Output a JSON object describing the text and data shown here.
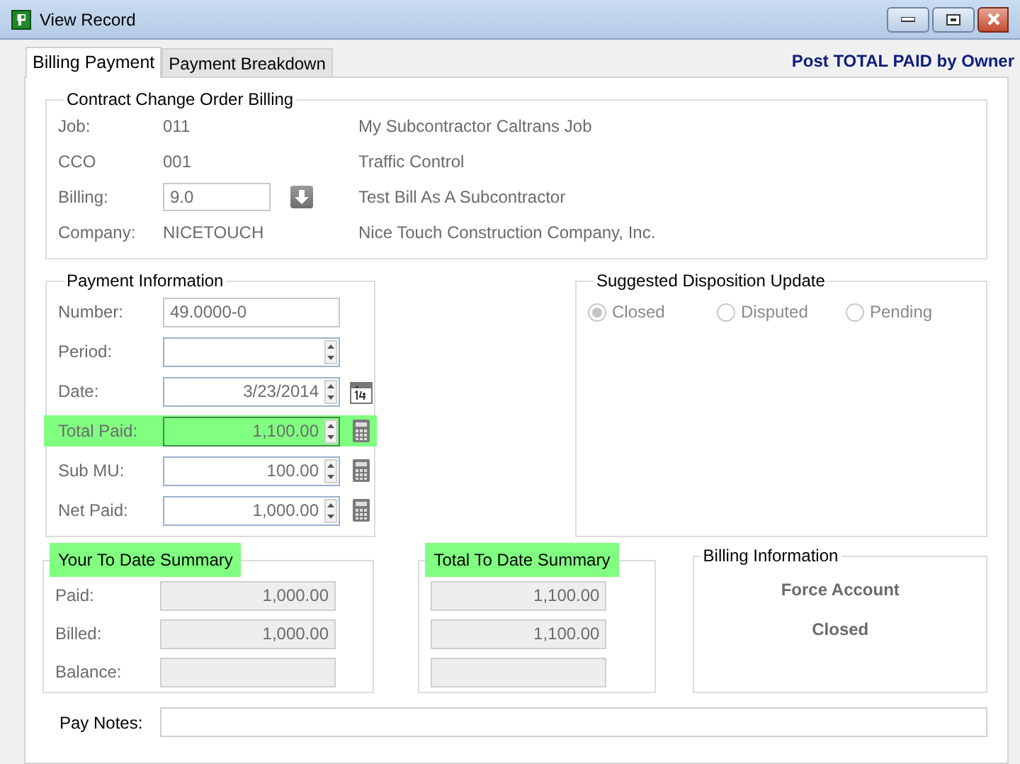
{
  "window": {
    "title": "View Record"
  },
  "tabs": [
    {
      "label": "Billing Payment",
      "selected": true
    },
    {
      "label": "Payment Breakdown",
      "selected": false
    }
  ],
  "header_link": "Post TOTAL PAID by Owner",
  "contract_change_order_billing": {
    "title": "Contract Change Order Billing",
    "rows": [
      {
        "label": "Job:",
        "value": "011",
        "kind": "plain",
        "description": "My Subcontractor Caltrans Job"
      },
      {
        "label": "CCO",
        "value": "001",
        "kind": "plain",
        "description": "Traffic Control"
      },
      {
        "label": "Billing:",
        "value": "9.0",
        "kind": "lookup",
        "description": "Test Bill As A Subcontractor"
      },
      {
        "label": "Company:",
        "value": "NICETOUCH",
        "kind": "plain",
        "description": "Nice Touch Construction Company, Inc."
      }
    ]
  },
  "payment_information": {
    "title": "Payment Information",
    "fields": [
      {
        "label": "Number:",
        "value": "49.0000-0",
        "kind": "text",
        "highlighted": false
      },
      {
        "label": "Period:",
        "kind": "spin",
        "highlighted": false
      },
      {
        "label": "Date:",
        "value": "3/23/2014",
        "kind": "date",
        "highlighted": false
      },
      {
        "label": "Total Paid:",
        "value": "1,100.00",
        "kind": "amount",
        "highlighted": true
      },
      {
        "label": "Sub MU:",
        "value": "100.00",
        "kind": "amount",
        "highlighted": false
      },
      {
        "label": "Net Paid:",
        "value": "1,000.00",
        "kind": "amount",
        "highlighted": false
      }
    ]
  },
  "suggested_disposition_update": {
    "title": "Suggested Disposition Update",
    "disabled": true,
    "options": [
      {
        "label": "Closed",
        "selected": true
      },
      {
        "label": "Disputed",
        "selected": false
      },
      {
        "label": "Pending",
        "selected": false
      }
    ]
  },
  "your_to_date_summary": {
    "title": "Your To Date Summary",
    "highlighted": true,
    "fields": [
      {
        "label": "Paid:",
        "value": "1,000.00",
        "disabled": true
      },
      {
        "label": "Billed:",
        "value": "1,000.00",
        "disabled": true
      },
      {
        "label": "Balance:",
        "disabled": true
      }
    ]
  },
  "total_to_date_summary": {
    "title": "Total To Date Summary",
    "highlighted": true,
    "fields": [
      {
        "value": "1,100.00",
        "disabled": true
      },
      {
        "value": "1,100.00",
        "disabled": true
      },
      {
        "disabled": true
      }
    ]
  },
  "billing_information": {
    "title": "Billing Information",
    "lines": [
      "Force Account",
      "Closed"
    ]
  },
  "pay_notes": {
    "label": "Pay Notes:"
  }
}
